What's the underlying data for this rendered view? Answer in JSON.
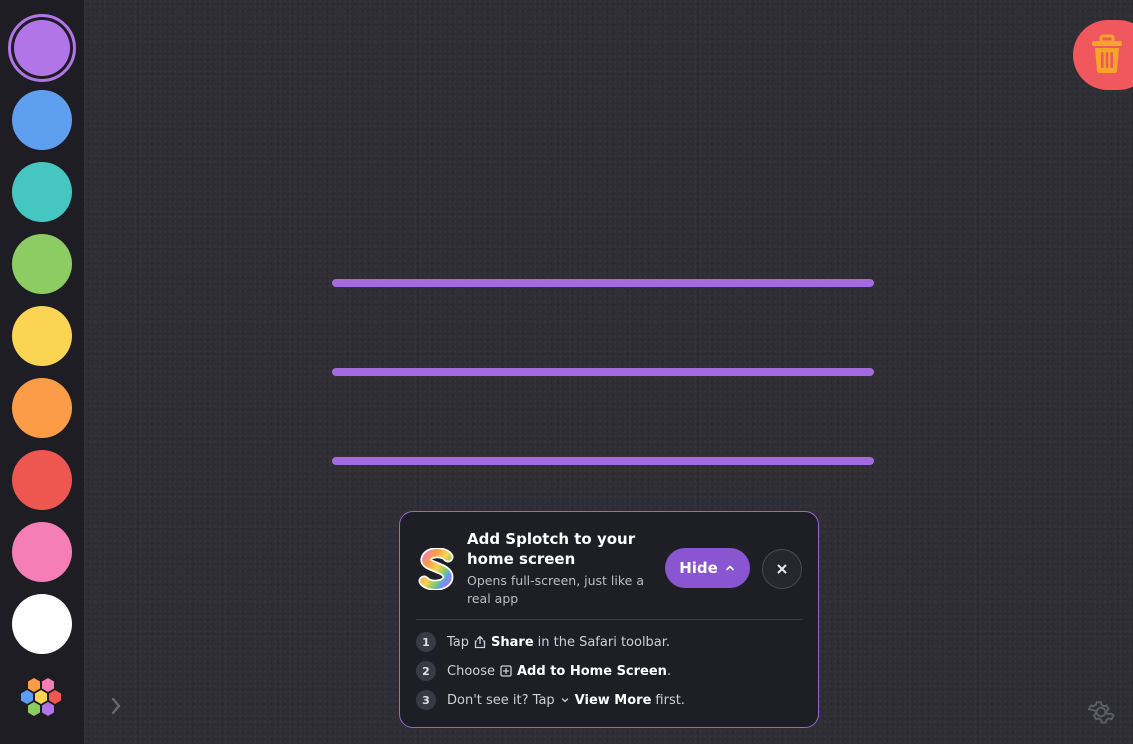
{
  "toolbar": {
    "colors": [
      "#b275e8",
      "#5e9ff0",
      "#46c6c0",
      "#8ccc62",
      "#fbd452",
      "#fd9c46",
      "#ee5650",
      "#f47eb5",
      "#ffffff"
    ],
    "selected_color_index": 0,
    "palette_icon": "hexagon-palette-icon",
    "expand_icon": "chevron-right-icon"
  },
  "trash": {
    "icon": "trash-icon",
    "color": "#f0585d"
  },
  "settings": {
    "icon": "gear-icon"
  },
  "canvas": {
    "stroke_color": "#a56ae0",
    "stroke_count": 3
  },
  "install_prompt": {
    "title": "Add Splotch to your home screen",
    "subtitle": "Opens full-screen, just like a real app",
    "hide_label": "Hide",
    "close_icon": "close-icon",
    "steps": [
      {
        "num": "1",
        "pre": "Tap",
        "icon": "share-icon",
        "bold": "Share",
        "post": "in the Safari toolbar."
      },
      {
        "num": "2",
        "pre": "Choose",
        "icon": "add-square-icon",
        "bold": "Add to Home Screen",
        "post": "."
      },
      {
        "num": "3",
        "pre": "Don't see it? Tap",
        "icon": "chevron-down-icon",
        "bold": "View More",
        "post": "first."
      }
    ]
  }
}
